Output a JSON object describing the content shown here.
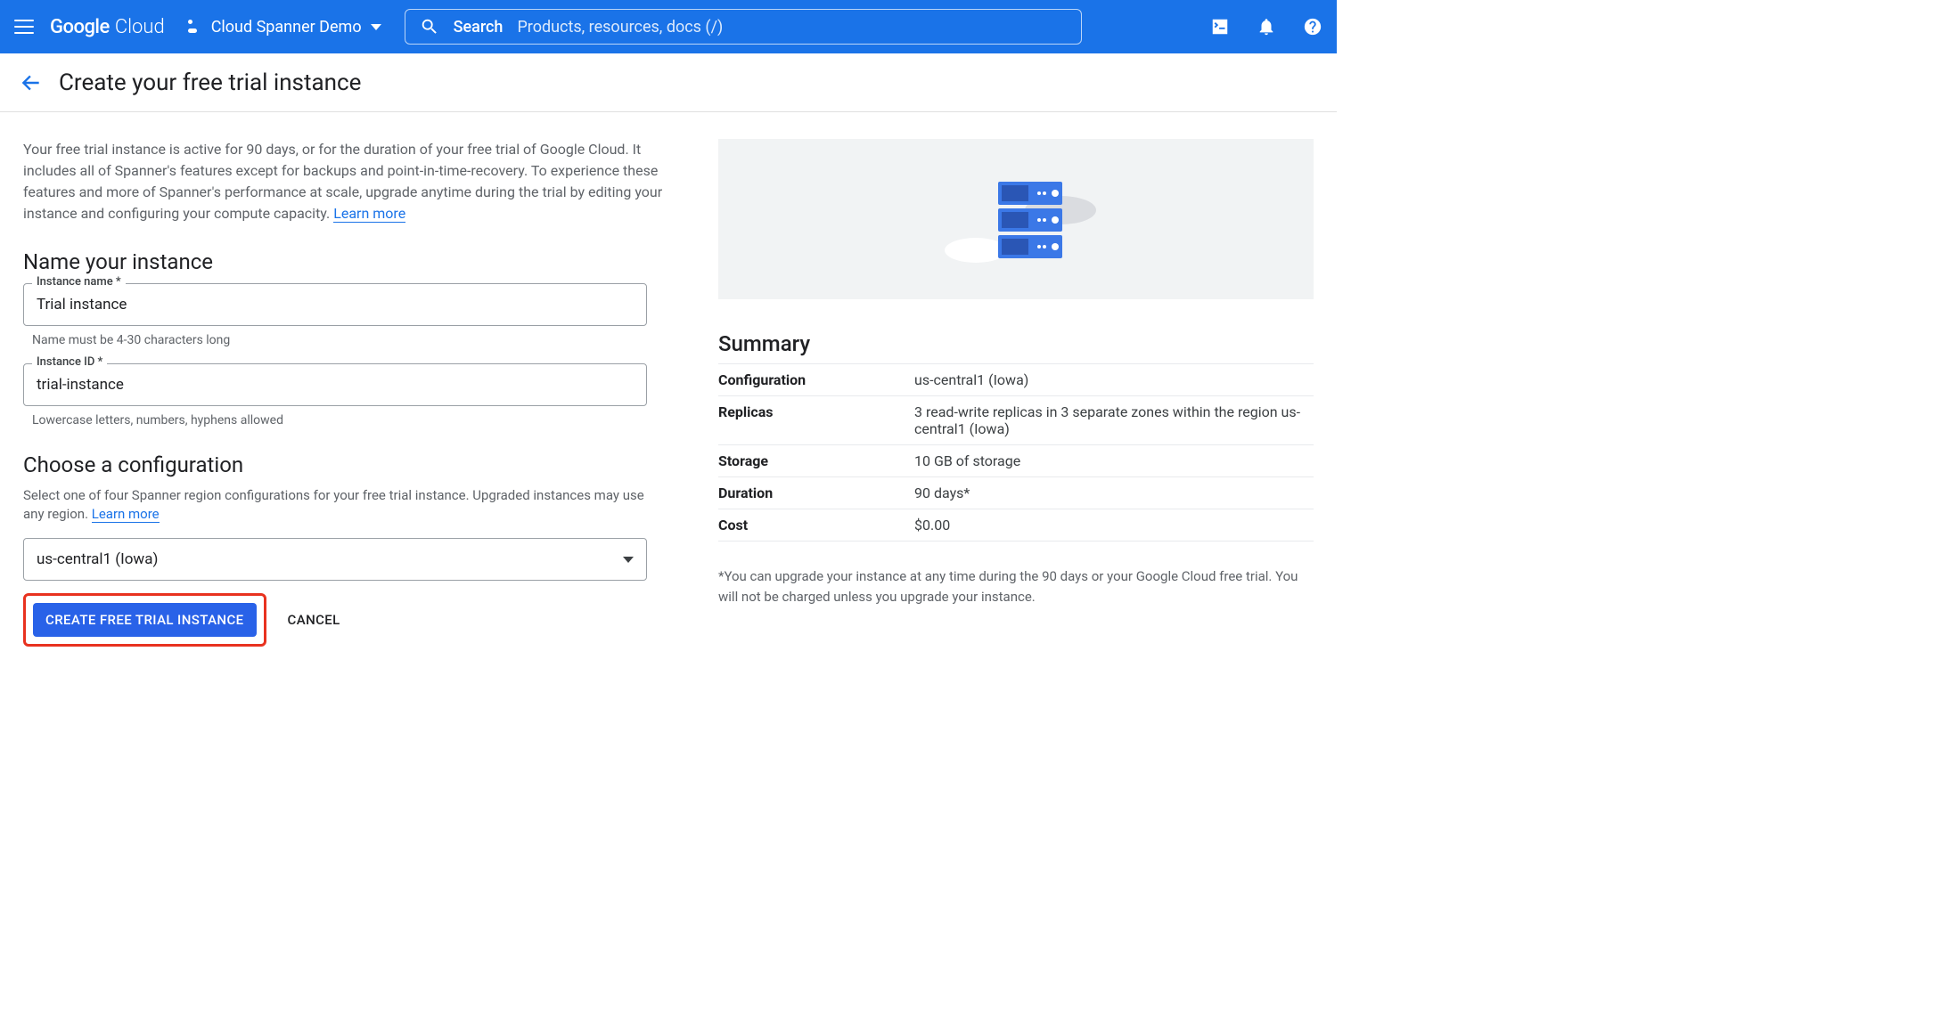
{
  "header": {
    "logo_google": "Google",
    "logo_cloud": "Cloud",
    "project_name": "Cloud Spanner Demo",
    "search_label": "Search",
    "search_placeholder": "Products, resources, docs (/)"
  },
  "page": {
    "title": "Create your free trial instance",
    "intro": "Your free trial instance is active for 90 days, or for the duration of your free trial of Google Cloud. It includes all of Spanner's features except for backups and point-in-time-recovery. To experience these features and more of Spanner's performance at scale, upgrade anytime during the trial by editing your instance and configuring your compute capacity. ",
    "learn_more": "Learn more"
  },
  "name_section": {
    "title": "Name your instance",
    "instance_name_label": "Instance name *",
    "instance_name_value": "Trial instance",
    "instance_name_hint": "Name must be 4-30 characters long",
    "instance_id_label": "Instance ID *",
    "instance_id_value": "trial-instance",
    "instance_id_hint": "Lowercase letters, numbers, hyphens allowed"
  },
  "config_section": {
    "title": "Choose a configuration",
    "desc": "Select one of four Spanner region configurations for your free trial instance. Upgraded instances may use any region. ",
    "learn_more": "Learn more",
    "selected": "us-central1 (Iowa)"
  },
  "actions": {
    "create": "CREATE FREE TRIAL INSTANCE",
    "cancel": "CANCEL"
  },
  "summary": {
    "title": "Summary",
    "rows": [
      {
        "k": "Configuration",
        "v": "us-central1 (Iowa)"
      },
      {
        "k": "Replicas",
        "v": "3 read-write replicas in 3 separate zones within the region us-central1 (Iowa)"
      },
      {
        "k": "Storage",
        "v": "10 GB of storage"
      },
      {
        "k": "Duration",
        "v": "90 days*"
      },
      {
        "k": "Cost",
        "v": "$0.00"
      }
    ],
    "footnote": "*You can upgrade your instance at any time during the 90 days or your Google Cloud free trial. You will not be charged unless you upgrade your instance."
  }
}
